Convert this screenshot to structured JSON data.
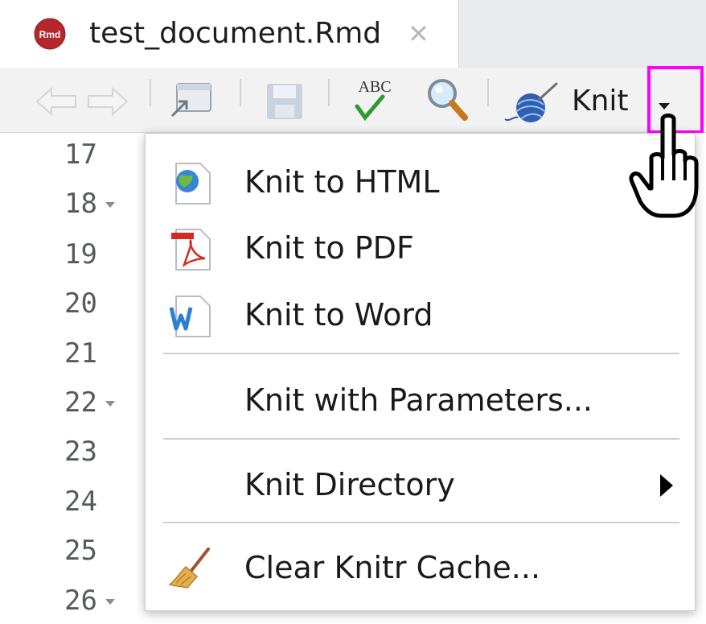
{
  "tab": {
    "icon_label": "Rmd",
    "title": "test_document.Rmd",
    "close_glyph": "✕"
  },
  "toolbar": {
    "knit_label": "Knit",
    "spell_label": "ABC"
  },
  "editor": {
    "lines": [
      {
        "num": "17",
        "fold": false
      },
      {
        "num": "18",
        "fold": true
      },
      {
        "num": "19",
        "fold": false
      },
      {
        "num": "20",
        "fold": false
      },
      {
        "num": "21",
        "fold": false
      },
      {
        "num": "22",
        "fold": true
      },
      {
        "num": "23",
        "fold": false
      },
      {
        "num": "24",
        "fold": false
      },
      {
        "num": "25",
        "fold": false
      },
      {
        "num": "26",
        "fold": true
      }
    ]
  },
  "menu": {
    "items": [
      {
        "label": "Knit to HTML",
        "icon": "html-globe-icon"
      },
      {
        "label": "Knit to PDF",
        "icon": "pdf-icon"
      },
      {
        "label": "Knit to Word",
        "icon": "word-icon"
      },
      {
        "label": "Knit with Parameters...",
        "icon": ""
      },
      {
        "label": "Knit Directory",
        "icon": "",
        "submenu": true
      },
      {
        "label": "Clear Knitr Cache...",
        "icon": "broom-icon"
      }
    ]
  },
  "colors": {
    "highlight": "#ff00ff",
    "rmd_badge": "#b5262d"
  }
}
